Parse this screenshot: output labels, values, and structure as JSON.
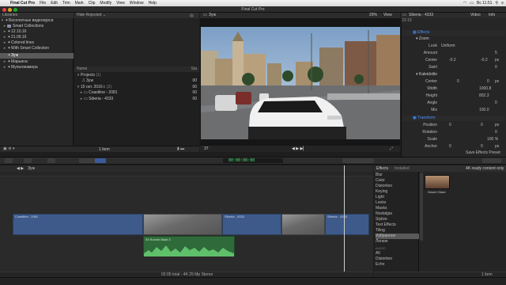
{
  "menubar": {
    "app": "Final Cut Pro",
    "items": [
      "File",
      "Edit",
      "Trim",
      "Mark",
      "Clip",
      "Modify",
      "View",
      "Window",
      "Help"
    ],
    "clock": "Вс 11:51"
  },
  "window_title": "Final Cut Pro",
  "libraries": {
    "header": "Libraries",
    "items": [
      {
        "label": "Бесплатные видеокурси"
      },
      {
        "label": "Smart Collections"
      },
      {
        "label": "12.10.16"
      },
      {
        "label": "21.09.16"
      },
      {
        "label": "Colored lines"
      },
      {
        "label": "With Smart Collection"
      },
      {
        "label": "Зуж"
      },
      {
        "label": "Марьина"
      },
      {
        "label": "Мультикамера"
      }
    ],
    "footer_count": "8 items"
  },
  "browser": {
    "filter": "Hide Rejected",
    "column_name": "Name",
    "column_start": "Sta",
    "rows": [
      {
        "label": "Projects",
        "count": "(1)"
      },
      {
        "label": "Зуж",
        "time": "00"
      },
      {
        "label": "15 окт. 2016 г.",
        "count": "(2)",
        "time": "00"
      },
      {
        "label": "Coastline - 2081",
        "time": "00"
      },
      {
        "label": "Siberia - 4333",
        "time": "00"
      }
    ],
    "footer": "1 item"
  },
  "viewer": {
    "title": "Зуж",
    "zoom": "29%",
    "view_menu": "View",
    "timecode_field": "37"
  },
  "inspector": {
    "clip_name": "Siberia - 4333",
    "clip_time": "23:10",
    "tabs": [
      "Video",
      "Info"
    ],
    "sections": {
      "effects": "Effects",
      "zoom": "Zoom",
      "kaleido": "Kaleidotile",
      "transform": "Transform"
    },
    "zoom_params": [
      {
        "label": "Look",
        "value": "Uniform"
      },
      {
        "label": "Amount",
        "value": "5"
      },
      {
        "label": "Center",
        "x": "-0.2",
        "y": "-0.2",
        "unit": "px"
      },
      {
        "label": "Swirl",
        "value": "0"
      }
    ],
    "kaleido_params": [
      {
        "label": "Center",
        "x": "0",
        "y": "0",
        "unit": "px"
      },
      {
        "label": "Width",
        "value": "1000.8"
      },
      {
        "label": "Height",
        "value": "802.3"
      },
      {
        "label": "Angle",
        "value": "0"
      },
      {
        "label": "Mix",
        "value": "100.0"
      }
    ],
    "transform_params": [
      {
        "label": "Position",
        "x": "0",
        "y": "0",
        "unit": "px"
      },
      {
        "label": "Rotation",
        "value": "0"
      },
      {
        "label": "Scale",
        "value": "100 %"
      },
      {
        "label": "Anchor",
        "x": "0",
        "y": "0",
        "unit": "px"
      }
    ],
    "save_preset": "Save Effects Preset"
  },
  "toolbar": {
    "timecode": "00:00:00:00"
  },
  "timeline": {
    "project_name": "Зуж",
    "clips": [
      {
        "label": "Coastline - 2081"
      },
      {
        "label": "Siberia - 4333"
      },
      {
        "label": "Siberia - 4333"
      }
    ],
    "audio_clip": "04 Ronnie Blast 3",
    "status": "02:05 total - 4K 25 Mp Stereo"
  },
  "effects": {
    "title": "Effects",
    "installed": "Installed",
    "filter": "4K ready content only",
    "categories": [
      "Blur",
      "Color",
      "Distortion",
      "Keying",
      "Light",
      "Looks",
      "Masks",
      "Nostalgia",
      "Stylize",
      "Text Effects",
      "Tiling",
      "Избранное",
      "Легкие"
    ],
    "audio_heading": "AUDIO",
    "audio_categories": [
      "All",
      "Distortion",
      "Echo"
    ],
    "selected_category": "Избранное",
    "thumb_label": "Desert Glare",
    "footer_count": "1 item"
  },
  "colors": {
    "accent": "#4a90ff",
    "clip_blue": "#3d5a8a",
    "audio_green": "#2f6b3a"
  }
}
